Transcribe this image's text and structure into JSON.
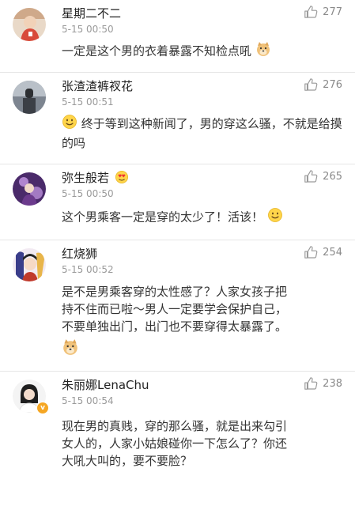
{
  "comments": [
    {
      "name": "星期二不二",
      "time": "5-15 00:50",
      "likes": "277",
      "text": "一定是这个男的衣着暴露不知检点吼",
      "emoji_after": "doge-icon"
    },
    {
      "name": "张渣渣裤衩花",
      "time": "5-15 00:51",
      "likes": "276",
      "emoji_before": "smile-icon",
      "text": "终于等到这种新闻了，男的穿这么骚，不就是给摸的吗"
    },
    {
      "name": "弥生般若",
      "name_emoji": "heart-eyes-icon",
      "time": "5-15 00:50",
      "likes": "265",
      "text": "这个男乘客一定是穿的太少了！活该！",
      "emoji_after": "smile-icon"
    },
    {
      "name": "红烧狮",
      "time": "5-15 00:52",
      "likes": "254",
      "text_lines": [
        "是不是男乘客穿的太性感了？人家女孩子把",
        "持不住而已啦～男人一定要学会保护自己，",
        "不要单独出门，出门也不要穿得太暴露了。"
      ],
      "emoji_line": "doge-icon"
    },
    {
      "name": "朱丽娜LenaChu",
      "time": "5-15 00:54",
      "likes": "238",
      "verified": true,
      "text_lines": [
        "现在男的真贱，穿的那么骚，就是出来勾引",
        "女人的，人家小姑娘碰你一下怎么了？你还",
        "大吼大叫的，要不要脸？"
      ]
    }
  ],
  "colors": {
    "name": "#222222",
    "meta": "#9a9a9a",
    "text": "#333333",
    "divider": "#e6e6e6",
    "verified_badge": "#f5a623"
  }
}
